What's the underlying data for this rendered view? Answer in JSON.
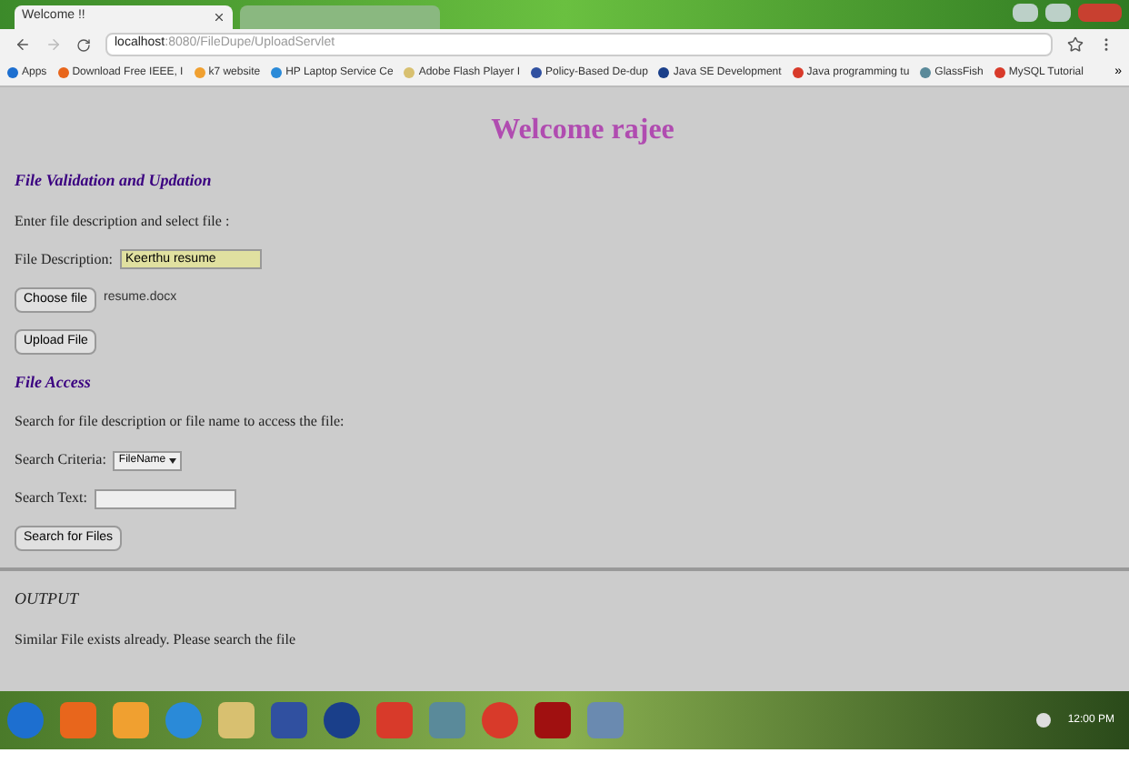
{
  "browser": {
    "tabs": [
      {
        "title": "Welcome !!",
        "selected": true
      },
      {
        "selected": false
      }
    ],
    "url_host": "localhost",
    "url_path": ":8080/FileDupe/UploadServlet",
    "bookmarks": [
      "Apps",
      "Download Free IEEE, I",
      "k7 website",
      "HP Laptop Service Ce",
      "Adobe Flash Player I",
      "Policy-Based De-dup",
      "Java SE Development",
      "Java programming tu",
      "GlassFish",
      "MySQL Tutorial"
    ],
    "more": "»"
  },
  "page": {
    "heading": "Welcome rajee",
    "upload": {
      "title": "File Validation and Updation",
      "instruction": "Enter file description and select file :",
      "description_label": "File Description:",
      "description_value": "Keerthu resume",
      "choose_button": "Choose file",
      "chosen_file": "resume.docx",
      "upload_button": "Upload File"
    },
    "access": {
      "title": "File Access",
      "instruction": "Search for file description or file name to access the file:",
      "criteria_label": "Search Criteria:",
      "criteria_value": "FileName",
      "search_label": "Search Text:",
      "search_button": "Search for Files"
    },
    "output": {
      "title": "OUTPUT",
      "message": "Similar File exists already. Please search the file"
    }
  },
  "taskbar": {
    "clock": "12:00 PM"
  }
}
